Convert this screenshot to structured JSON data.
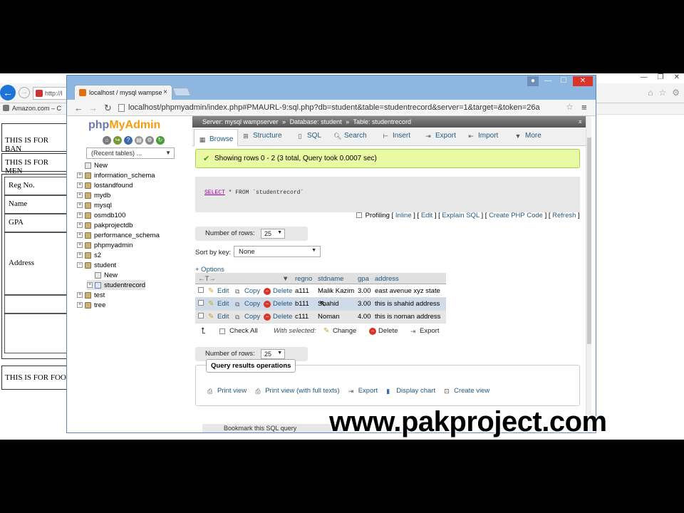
{
  "background_window": {
    "url_text": "http://l",
    "bookmark": "Amazon.com – C",
    "blocks": [
      "THIS IS FOR BAN",
      "THIS IS FOR MEN",
      "THIS IS FOR FOO"
    ],
    "form_labels": [
      "Reg No.",
      "Name",
      "GPA",
      "Address"
    ]
  },
  "browser": {
    "tab_title": "localhost / mysql wampse",
    "tab_close": "×",
    "url": "localhost/phpmyadmin/index.php#PMAURL-9:sql.php?db=student&table=studentrecord&server=1&target=&token=26a"
  },
  "nav": {
    "logo_php": "php",
    "logo_myadmin": "MyAdmin",
    "recent_tables": "(Recent tables) ...",
    "tree": [
      {
        "label": "New",
        "kind": "new",
        "depth": 0
      },
      {
        "label": "information_schema",
        "kind": "db",
        "depth": 0
      },
      {
        "label": "lostandfound",
        "kind": "db",
        "depth": 0
      },
      {
        "label": "mydb",
        "kind": "db",
        "depth": 0
      },
      {
        "label": "mysql",
        "kind": "db",
        "depth": 0
      },
      {
        "label": "osmdb100",
        "kind": "db",
        "depth": 0
      },
      {
        "label": "pakprojectdb",
        "kind": "db",
        "depth": 0
      },
      {
        "label": "performance_schema",
        "kind": "db",
        "depth": 0
      },
      {
        "label": "phpmyadmin",
        "kind": "db",
        "depth": 0
      },
      {
        "label": "s2",
        "kind": "db",
        "depth": 0
      },
      {
        "label": "student",
        "kind": "db",
        "depth": 0
      },
      {
        "label": "New",
        "kind": "new",
        "depth": 1
      },
      {
        "label": "studentrecord",
        "kind": "table",
        "depth": 1
      },
      {
        "label": "test",
        "kind": "db",
        "depth": 0
      },
      {
        "label": "tree",
        "kind": "db",
        "depth": 0
      }
    ]
  },
  "breadcrumb": {
    "server": "Server: mysql wampserver",
    "database": "Database: student",
    "table": "Table: studentrecord",
    "sep": "»"
  },
  "tabs": [
    "Browse",
    "Structure",
    "SQL",
    "Search",
    "Insert",
    "Export",
    "Import",
    "More"
  ],
  "success_message": "Showing rows 0 - 2 (3 total, Query took 0.0007 sec)",
  "sql": {
    "select": "SELECT",
    "rest": " * FROM `studentrecord`"
  },
  "profiling": {
    "label": "Profiling",
    "links": [
      "Inline",
      "Edit",
      "Explain SQL",
      "Create PHP Code",
      "Refresh"
    ]
  },
  "number_of_rows_label": "Number of rows:",
  "number_of_rows_value": "25",
  "sort_by_key_label": "Sort by key:",
  "sort_by_key_value": "None",
  "options_label": "+ Options",
  "grid": {
    "columns": [
      "regno",
      "stdname",
      "gpa",
      "address"
    ],
    "actions": [
      "Edit",
      "Copy",
      "Delete"
    ],
    "rows": [
      {
        "regno": "a111",
        "stdname": "Malik Kazim",
        "gpa": "3.00",
        "address": "east avenue xyz state"
      },
      {
        "regno": "b111",
        "stdname": "Shahid",
        "gpa": "3.00",
        "address": "this is shahid address"
      },
      {
        "regno": "c111",
        "stdname": "Noman",
        "gpa": "4.00",
        "address": "this is noman address"
      }
    ]
  },
  "with_selected": {
    "check_all": "Check All",
    "label": "With selected:",
    "change": "Change",
    "delete": "Delete",
    "export": "Export"
  },
  "query_results_operations": {
    "legend": "Query results operations",
    "items": [
      "Print view",
      "Print view (with full texts)",
      "Export",
      "Display chart",
      "Create view"
    ]
  },
  "bookmark_label": "Bookmark this SQL query",
  "watermark": "www.pakproject.com"
}
